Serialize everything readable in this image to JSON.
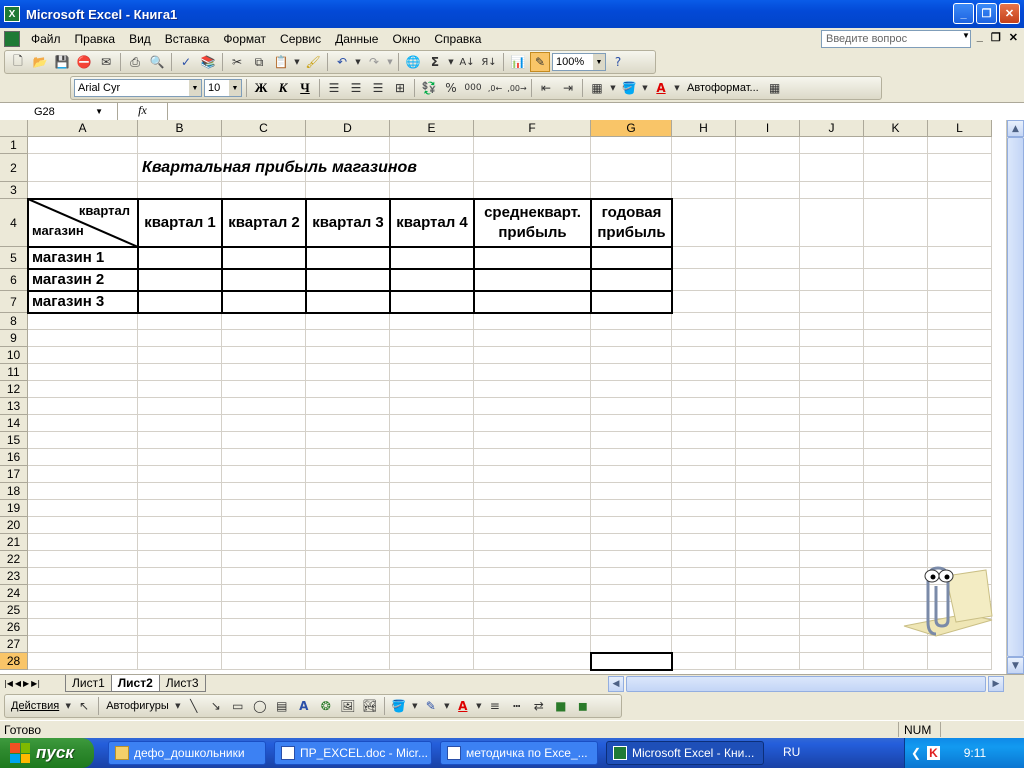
{
  "window": {
    "title": "Microsoft Excel - Книга1"
  },
  "menu": {
    "items": [
      "Файл",
      "Правка",
      "Вид",
      "Вставка",
      "Формат",
      "Сервис",
      "Данные",
      "Окно",
      "Справка"
    ],
    "ask_placeholder": "Введите вопрос"
  },
  "standard_toolbar": {
    "zoom": "100%"
  },
  "formatting_toolbar": {
    "font": "Arial Cyr",
    "size": "10",
    "bold": "Ж",
    "italic": "К",
    "underline": "Ч",
    "percent": "%",
    "thousands": "000",
    "autoformat": "Автоформат..."
  },
  "formula_bar": {
    "name_box": "G28",
    "fx": "fx",
    "content": ""
  },
  "columns": [
    "A",
    "B",
    "C",
    "D",
    "E",
    "F",
    "G",
    "H",
    "I",
    "J",
    "K",
    "L"
  ],
  "rows": [
    "1",
    "2",
    "3",
    "4",
    "5",
    "6",
    "7",
    "8",
    "9",
    "10",
    "11",
    "12",
    "13",
    "14",
    "15",
    "16",
    "17",
    "18",
    "19",
    "20",
    "21",
    "22",
    "23",
    "24",
    "25",
    "26",
    "27",
    "28"
  ],
  "selected_cell": "G28",
  "sheet": {
    "title": "Квартальная прибыль магазинов",
    "header_corner_top": "квартал",
    "header_corner_bottom": "магазин",
    "headers": [
      "квартал 1",
      "квартал 2",
      "квартал 3",
      "квартал 4",
      "среднекварт. прибыль",
      "годовая прибыль"
    ],
    "rows": [
      "магазин 1",
      "магазин 2",
      "магазин 3"
    ]
  },
  "sheet_tabs": [
    "Лист1",
    "Лист2",
    "Лист3"
  ],
  "active_tab": "Лист2",
  "drawing_toolbar": {
    "actions": "Действия",
    "autoshapes": "Автофигуры"
  },
  "status": {
    "ready": "Готово",
    "num": "NUM"
  },
  "taskbar": {
    "start": "пуск",
    "tasks": [
      "дефо_дошкольники",
      "ПР_EXCEL.doc - Micr...",
      "методичка по Exce_...",
      "Microsoft Excel - Кни..."
    ],
    "lang": "RU",
    "time": "9:11"
  },
  "colors": {
    "accent": "#0a5ce8",
    "selected_header": "#f9c568",
    "gridline": "#d4d0c8"
  }
}
